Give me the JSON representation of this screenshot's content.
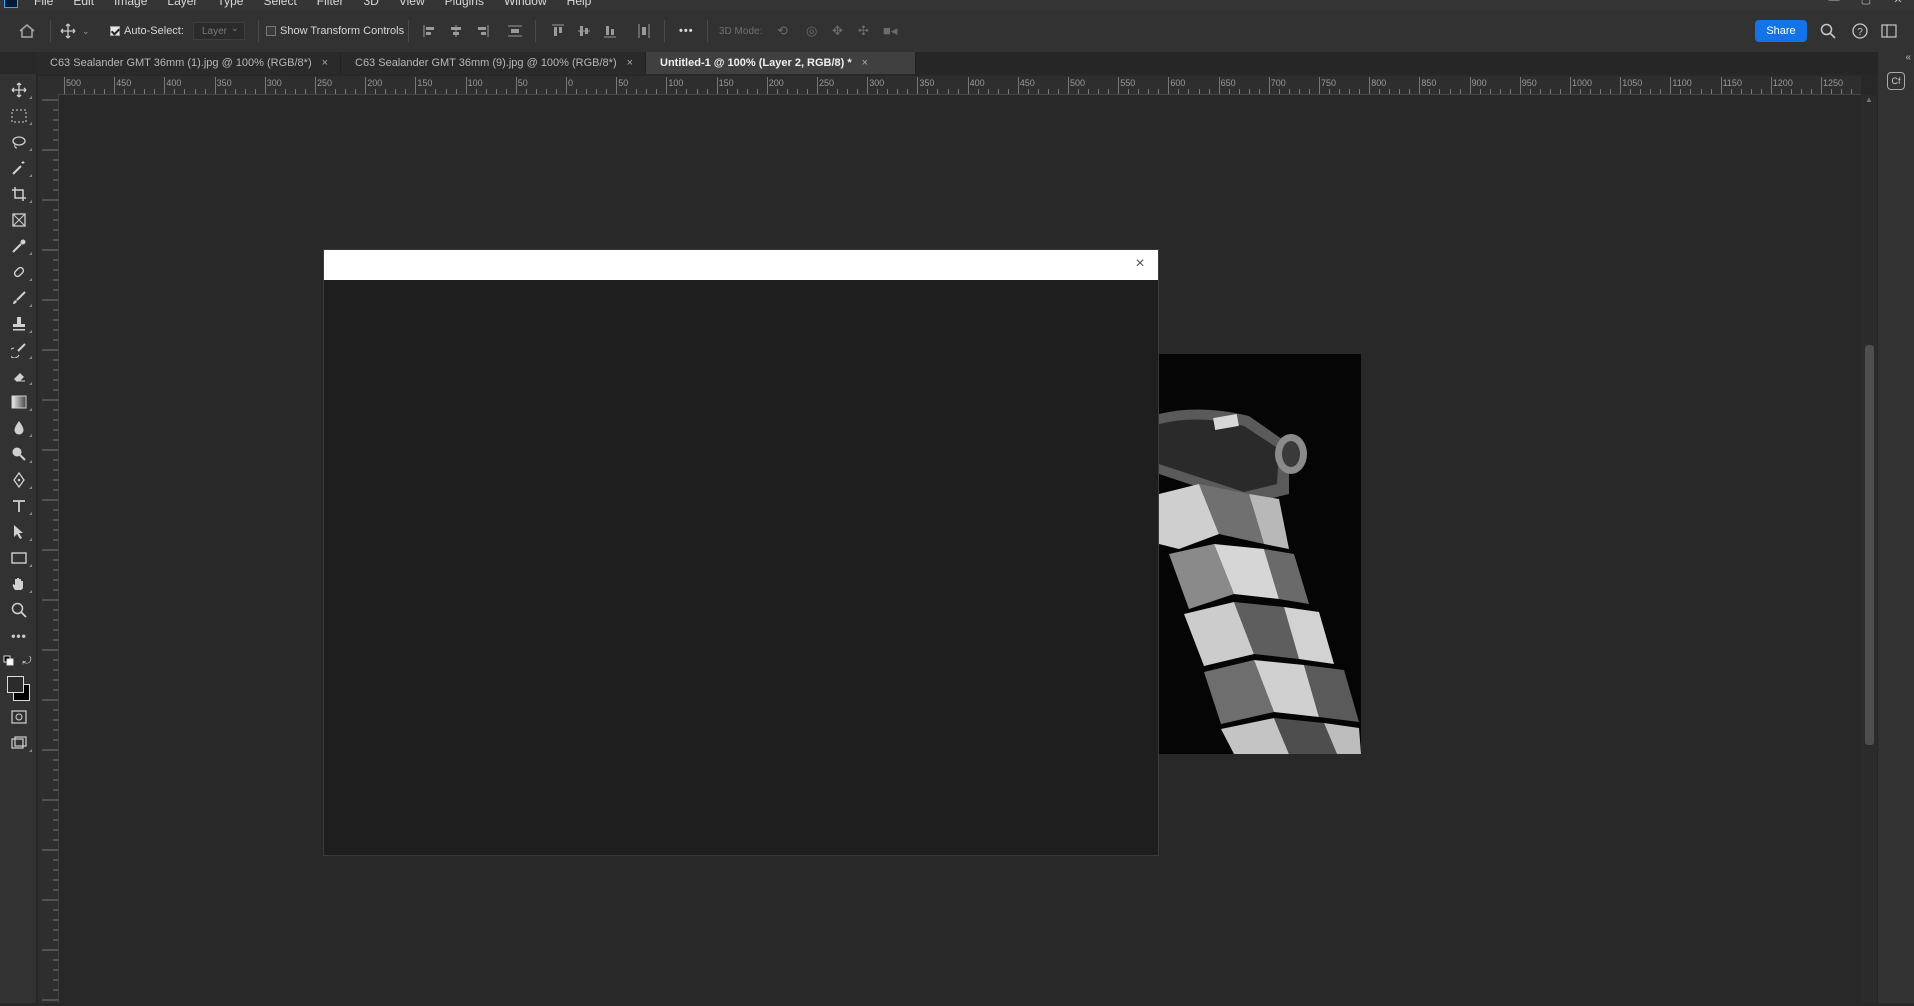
{
  "app": {
    "menus": [
      "File",
      "Edit",
      "Image",
      "Layer",
      "Type",
      "Select",
      "Filter",
      "3D",
      "View",
      "Plugins",
      "Window",
      "Help"
    ]
  },
  "options_bar": {
    "auto_select_label": "Auto-Select:",
    "auto_select_checked": true,
    "target_select_value": "Layer",
    "show_transform_label": "Show Transform Controls",
    "show_transform_checked": false,
    "three_d_mode_label": "3D Mode:",
    "more_label": "•••",
    "share_label": "Share"
  },
  "tabs": [
    {
      "label": "C63 Sealander GMT 36mm (1).jpg @ 100% (RGB/8*)",
      "active": false
    },
    {
      "label": "C63 Sealander GMT 36mm (9).jpg @ 100% (RGB/8*)",
      "active": false
    },
    {
      "label": "Untitled-1 @ 100% (Layer 2, RGB/8) *",
      "active": true
    }
  ],
  "ruler": {
    "labels": [
      "500",
      "450",
      "400",
      "350",
      "300",
      "250",
      "200",
      "150",
      "100",
      "50",
      "0",
      "50",
      "100",
      "150",
      "200",
      "250",
      "300",
      "350",
      "400",
      "450",
      "500",
      "550",
      "600",
      "650",
      "700",
      "750",
      "800",
      "850",
      "900",
      "950",
      "1000",
      "1050",
      "1100",
      "1150",
      "1200",
      "1250"
    ]
  },
  "tools": [
    "move-tool",
    "marquee-tool",
    "lasso-tool",
    "magic-wand-tool",
    "crop-tool",
    "frame-tool",
    "eyedropper-tool",
    "healing-brush-tool",
    "brush-tool",
    "clone-stamp-tool",
    "history-brush-tool",
    "eraser-tool",
    "gradient-tool",
    "blur-tool",
    "dodge-tool",
    "pen-tool",
    "type-tool",
    "path-selection-tool",
    "rectangle-tool",
    "hand-tool",
    "zoom-tool",
    "edit-toolbar",
    "quick-mask",
    "screen-mode"
  ],
  "dialog": {
    "close_glyph": "×"
  }
}
